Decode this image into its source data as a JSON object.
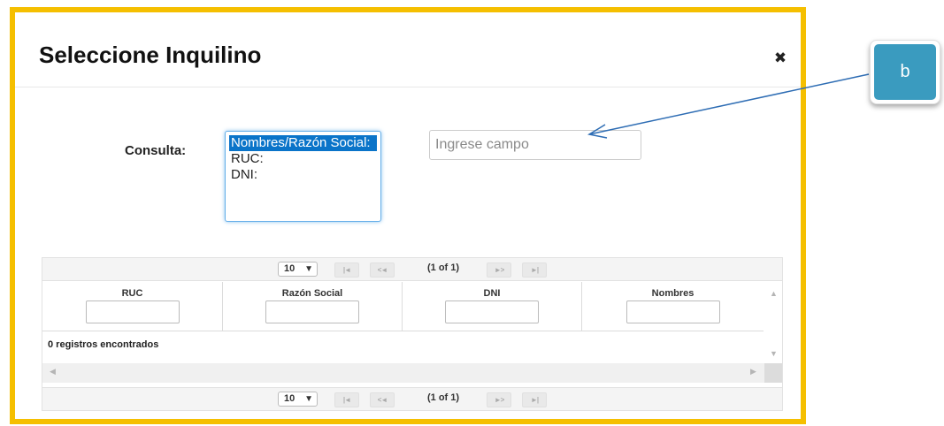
{
  "dialog": {
    "title": "Seleccione Inquilino",
    "close_icon": "close-icon"
  },
  "query": {
    "label": "Consulta:",
    "options": [
      "Nombres/Razón Social:",
      "RUC:",
      "DNI:"
    ],
    "selected": "Nombres/Razón Social:",
    "input_placeholder": "Ingrese campo",
    "input_value": ""
  },
  "table": {
    "rows_per_page": "10",
    "page_status": "(1 of 1)",
    "pager_buttons": {
      "first": "|◄",
      "prev": "<◄",
      "next": "►>",
      "last": "►|"
    },
    "columns": [
      "RUC",
      "Razón Social",
      "DNI",
      "Nombres"
    ],
    "filter_values": [
      "",
      "",
      "",
      ""
    ],
    "rows": [],
    "empty_message": "0 registros encontrados"
  },
  "annotation": {
    "callout_label": "b"
  },
  "colors": {
    "frame_border": "#f5bf00",
    "selected_option": "#0a74c9",
    "callout": "#3a9bbf",
    "arrow": "#2e6db4"
  }
}
